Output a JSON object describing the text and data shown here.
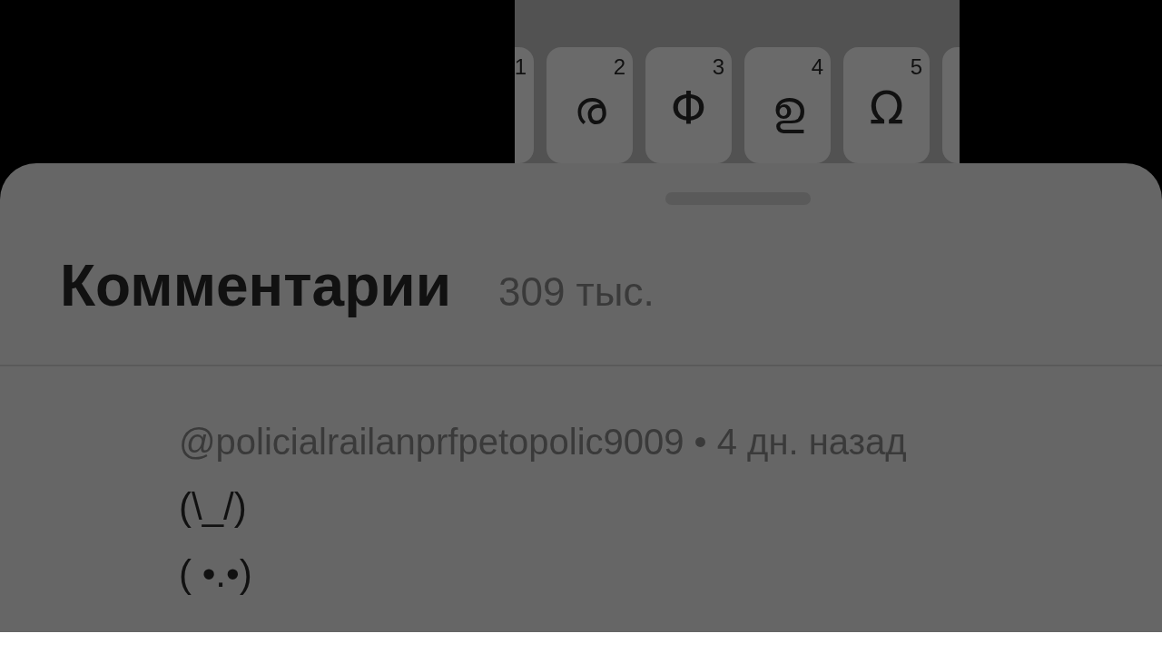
{
  "keyboard": {
    "keys": [
      {
        "number": "1"
      },
      {
        "number": "2",
        "glyph": "ര"
      },
      {
        "number": "3",
        "glyph": "Φ"
      },
      {
        "number": "4",
        "glyph": "ഉ"
      },
      {
        "number": "5",
        "glyph": "Ω"
      }
    ]
  },
  "comments_sheet": {
    "title": "Комментарии",
    "count": "309 тыс.",
    "comments": [
      {
        "author": "@policialrailanprfpetopolic9009",
        "separator": "•",
        "time": "4 дн. назад",
        "lines": [
          "(\\_/)",
          "( •.•)"
        ]
      }
    ]
  }
}
